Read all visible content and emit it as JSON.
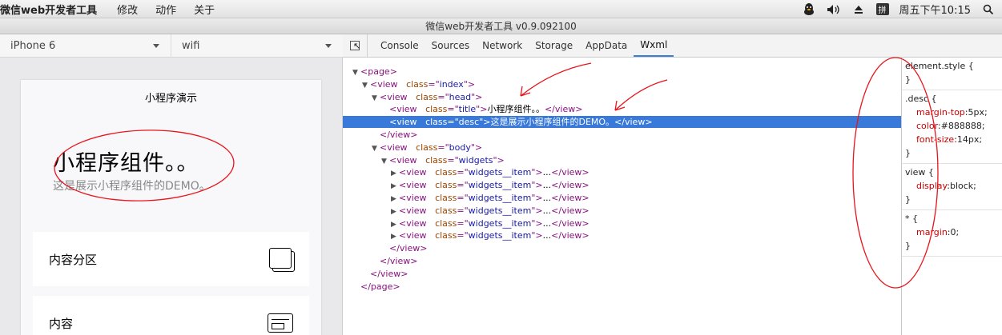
{
  "menubar": {
    "app_name": "微信web开发者工具",
    "items": [
      "修改",
      "动作",
      "关于"
    ],
    "ime_label": "拼",
    "clock": "周五下午10:15"
  },
  "window": {
    "title": "微信web开发者工具 v0.9.092100"
  },
  "simulator": {
    "device": "iPhone 6",
    "network": "wifi",
    "nav_title": "小程序演示",
    "page_title": "小程序组件。。",
    "page_desc": "这是展示小程序组件的DEMO。",
    "widgets": [
      {
        "label": "内容分区"
      },
      {
        "label": "内容"
      }
    ]
  },
  "devtools": {
    "tabs": [
      "Console",
      "Sources",
      "Network",
      "Storage",
      "AppData",
      "Wxml"
    ],
    "active_tab": "Wxml",
    "tree": [
      {
        "tri": "▼",
        "open": "<page>"
      },
      {
        "tri": "▼",
        "tag": "view",
        "attr": "class",
        "val": "index"
      },
      {
        "tri": "▼",
        "tag": "view",
        "attr": "class",
        "val": "head"
      },
      {
        "tri": "",
        "tag": "view",
        "attr": "class",
        "val": "title",
        "text": "小程序组件。。"
      },
      {
        "tri": "",
        "tag": "view",
        "attr": "class",
        "val": "desc",
        "text": "这是展示小程序组件的DEMO。"
      },
      {
        "tri": "",
        "close": "</view>"
      },
      {
        "tri": "▼",
        "tag": "view",
        "attr": "class",
        "val": "body"
      },
      {
        "tri": "▼",
        "tag": "view",
        "attr": "class",
        "val": "widgets"
      },
      {
        "tri": "▶",
        "tag": "view",
        "attr": "class",
        "val": "widgets__item",
        "text": "..."
      },
      {
        "tri": "▶",
        "tag": "view",
        "attr": "class",
        "val": "widgets__item",
        "text": "..."
      },
      {
        "tri": "▶",
        "tag": "view",
        "attr": "class",
        "val": "widgets__item",
        "text": "..."
      },
      {
        "tri": "▶",
        "tag": "view",
        "attr": "class",
        "val": "widgets__item",
        "text": "..."
      },
      {
        "tri": "▶",
        "tag": "view",
        "attr": "class",
        "val": "widgets__item",
        "text": "..."
      },
      {
        "tri": "▶",
        "tag": "view",
        "attr": "class",
        "val": "widgets__item",
        "text": "..."
      },
      {
        "tri": "",
        "close": "</view>"
      },
      {
        "tri": "",
        "close": "</view>"
      },
      {
        "tri": "",
        "close": "</view>"
      },
      {
        "tri": "",
        "close": "</page>"
      }
    ],
    "selected_row": 4,
    "styles": [
      {
        "selector": "element.style {",
        "props": [],
        "end": "}"
      },
      {
        "selector": ".desc {",
        "props": [
          {
            "name": "margin-top",
            "value": "5px;"
          },
          {
            "name": "color",
            "value": "#888888;"
          },
          {
            "name": "font-size",
            "value": "14px;"
          }
        ],
        "end": "}"
      },
      {
        "selector": "view {",
        "props": [
          {
            "name": "display",
            "value": "block;"
          }
        ],
        "end": "}"
      },
      {
        "selector": "* {",
        "props": [
          {
            "name": "margin",
            "value": "0;"
          }
        ],
        "end": "}"
      }
    ]
  },
  "colors": {
    "selection": "#3879d9",
    "annotation": "#e8141a",
    "tab_underline": "#3d7fd8"
  }
}
